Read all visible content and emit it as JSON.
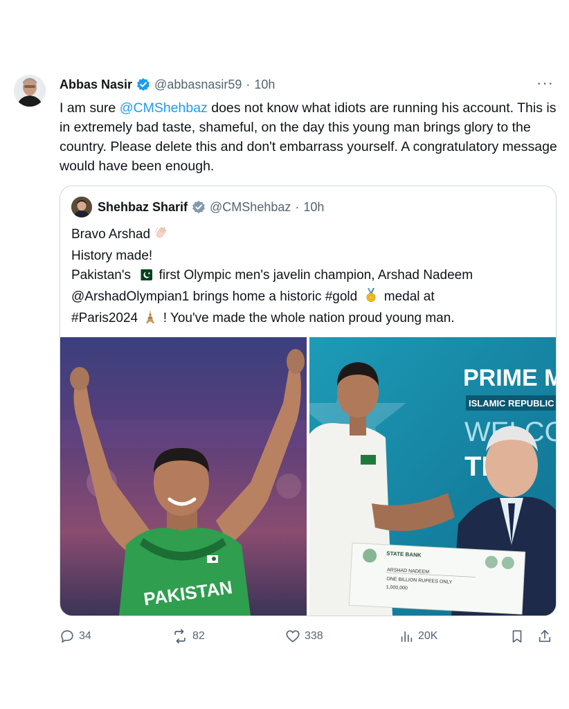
{
  "tweet": {
    "author_name": "Abbas Nasir",
    "author_handle": "@abbasnasir59",
    "separator": "·",
    "time": "10h",
    "more": "···",
    "text_before": "I am sure ",
    "mention": "@CMShehbaz",
    "text_after": " does not know what idiots are running his account. This is in extremely bad taste, shameful, on the day this young man brings glory to the country. Please delete this and don't embarrass yourself. A congratulatory message would have been enough."
  },
  "quote": {
    "author_name": "Shehbaz Sharif",
    "author_handle": "@CMShehbaz",
    "separator": "·",
    "time": "10h",
    "line1": "Bravo Arshad",
    "line2": "History made!",
    "line3_a": "Pakistan's",
    "line3_b": "first Olympic men's javelin champion, Arshad Nadeem",
    "line4_a": "@ArshadOlympian1 brings home a historic #gold",
    "line4_b": "medal at",
    "line5_a": "#Paris2024",
    "line5_b": "! You've made the whole nation proud young man.",
    "photo_left": {
      "jersey_text": "PAKISTAN"
    },
    "photo_right": {
      "banner_line1": "PRIME MI",
      "banner_line2": "ISLAMIC REPUBLIC",
      "banner_line3": "WELCO",
      "banner_line4": "TEA",
      "cheque_bank": "STATE BANK",
      "cheque_payto": "ARSHAD NADEEM",
      "cheque_amount": "ONE BILLION RUPEES ONLY",
      "cheque_number": "1,000,000"
    }
  },
  "actions": {
    "replies": "34",
    "reposts": "82",
    "likes": "338",
    "views": "20K"
  },
  "colors": {
    "accent": "#1d9bf0",
    "text": "#0f1419",
    "muted": "#536471",
    "border": "#cfd9de"
  }
}
